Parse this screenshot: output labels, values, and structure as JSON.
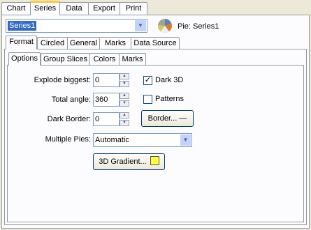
{
  "top_tabs": [
    "Chart",
    "Series",
    "Data",
    "Export",
    "Print"
  ],
  "series_select": {
    "value": "Series1"
  },
  "pie_label": "Pie: Series1",
  "format_tabs": [
    "Format",
    "Circled",
    "General",
    "Marks",
    "Data Source"
  ],
  "inner_tabs": [
    "Options",
    "Group Slices",
    "Colors",
    "Marks"
  ],
  "options": {
    "explode_label": "Explode biggest:",
    "explode_value": "0",
    "total_angle_label": "Total angle:",
    "total_angle_value": "360",
    "dark_border_label": "Dark Border:",
    "dark_border_value": "0",
    "multiple_pies_label": "Multiple Pies:",
    "multiple_pies_value": "Automatic",
    "dark3d_label": "Dark 3D",
    "dark3d_checked": true,
    "patterns_label": "Patterns",
    "patterns_checked": false,
    "border_button": "Border...",
    "gradient_button": "3D Gradient..."
  },
  "colors": {
    "selection": "#316ac5",
    "gradient_swatch": "#ffff33",
    "accent_tab": "#ffc73c"
  }
}
